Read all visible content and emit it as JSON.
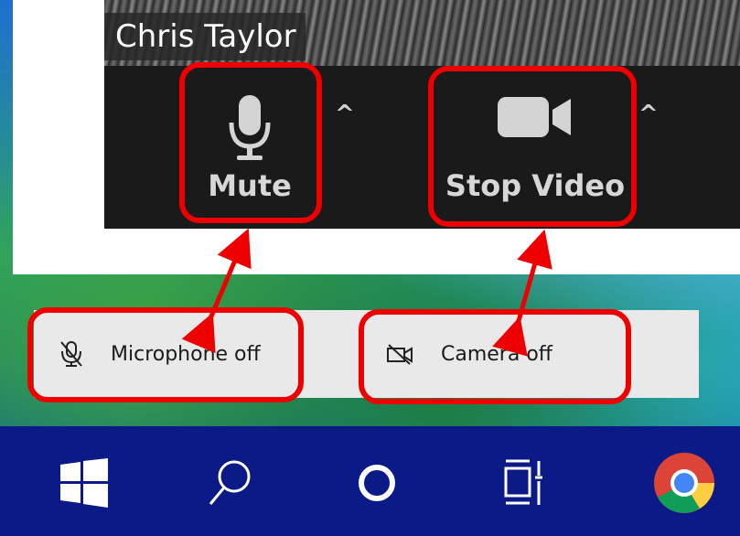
{
  "video": {
    "participant_name": "Chris Taylor"
  },
  "toolbar": {
    "mute_label": "Mute",
    "stop_video_label": "Stop Video",
    "caret_glyph": "^"
  },
  "notification_bar": {
    "microphone_label": "Microphone off",
    "camera_label": "Camera off"
  },
  "taskbar": {
    "icons": [
      "windows-start-icon",
      "search-icon",
      "cortana-icon",
      "task-view-icon",
      "chrome-icon"
    ]
  },
  "colors": {
    "highlight_red": "#ee0000",
    "background_blue": "#0b1a86",
    "toolbar_dark": "#1a1a1a",
    "notification_bg": "#e9e9ea"
  }
}
